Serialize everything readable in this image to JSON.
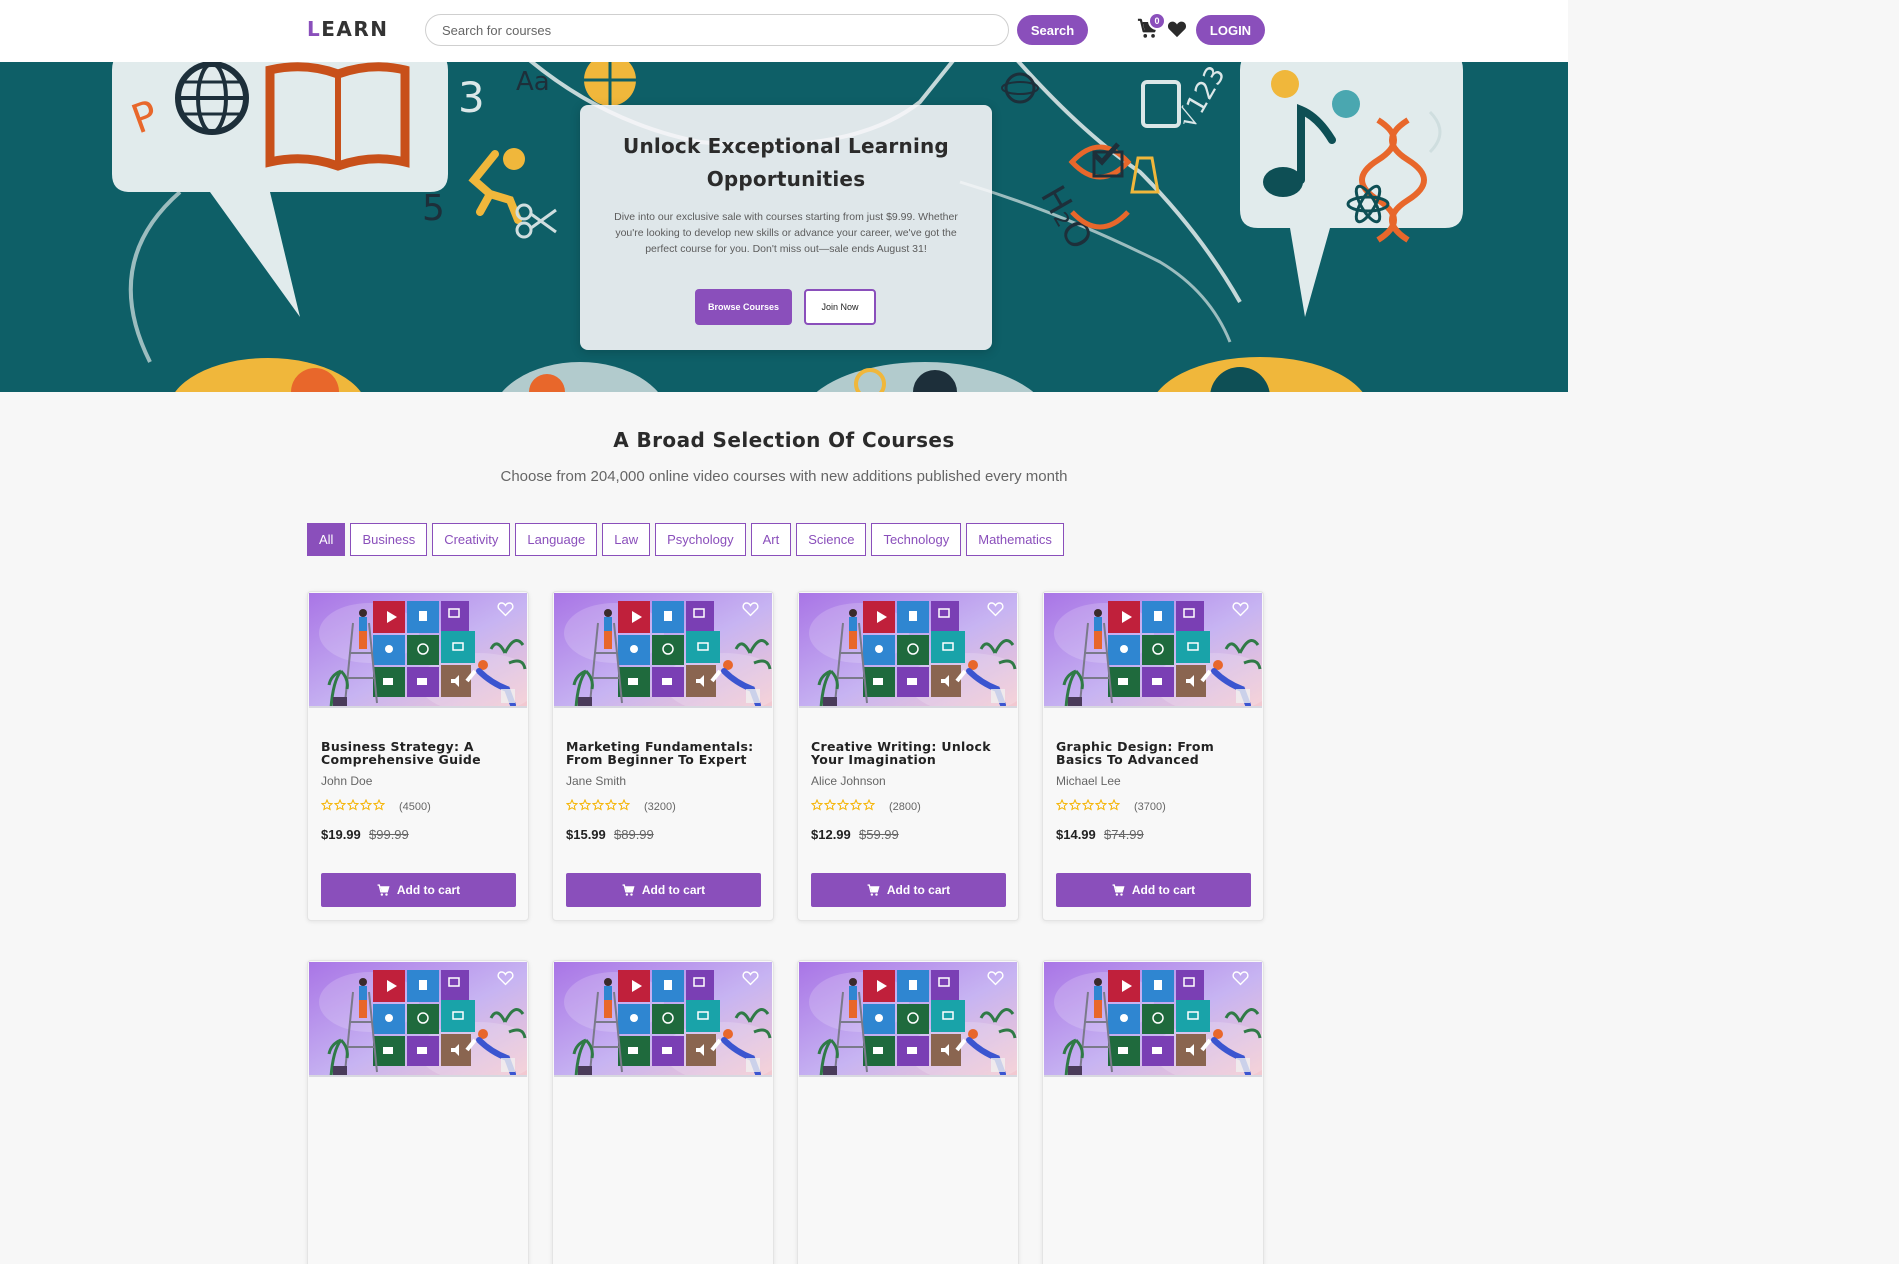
{
  "nav": {
    "logo_first": "L",
    "logo_rest": "EARN",
    "search_placeholder": "Search for courses",
    "search_label": "Search",
    "cart_count": "0",
    "login_label": "LOGIN"
  },
  "hero": {
    "title": "Unlock Exceptional Learning Opportunities",
    "text": "Dive into our exclusive sale with courses starting from just $9.99. Whether you're looking to develop new skills or advance your career, we've got the perfect course for you. Don't miss out—sale ends August 31!",
    "browse_label": "Browse Courses",
    "join_label": "Join Now"
  },
  "section": {
    "title": "A Broad Selection Of Courses",
    "subtitle": "Choose from 204,000 online video courses with new additions published every month"
  },
  "filters": [
    "All",
    "Business",
    "Creativity",
    "Language",
    "Law",
    "Psychology",
    "Art",
    "Science",
    "Technology",
    "Mathematics"
  ],
  "active_filter": "All",
  "courses": [
    {
      "title": "Business Strategy: A Comprehensive Guide",
      "author": "John Doe",
      "reviews": "(4500)",
      "price": "$19.99",
      "old_price": "$99.99",
      "button": "Add to cart"
    },
    {
      "title": "Marketing Fundamentals: From Beginner To Expert",
      "author": "Jane Smith",
      "reviews": "(3200)",
      "price": "$15.99",
      "old_price": "$89.99",
      "button": "Add to cart"
    },
    {
      "title": "Creative Writing: Unlock Your Imagination",
      "author": "Alice Johnson",
      "reviews": "(2800)",
      "price": "$12.99",
      "old_price": "$59.99",
      "button": "Add to cart"
    },
    {
      "title": "Graphic Design: From Basics To Advanced",
      "author": "Michael Lee",
      "reviews": "(3700)",
      "price": "$14.99",
      "old_price": "$74.99",
      "button": "Add to cart"
    }
  ],
  "colors": {
    "accent": "#8a4fbb",
    "hero_bg": "#0e5f67",
    "star": "#f5b301"
  }
}
